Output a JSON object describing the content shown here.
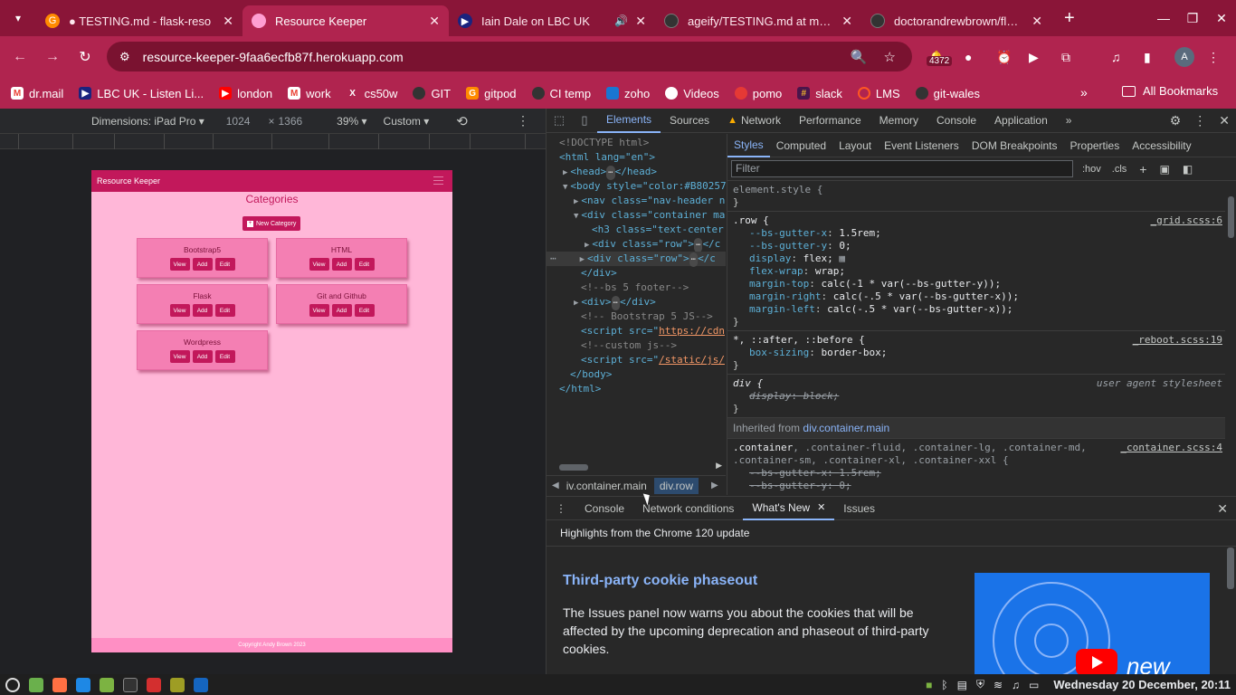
{
  "browser": {
    "tabs": [
      {
        "label": "● TESTING.md - flask-reso",
        "active": false,
        "icon": "gitpod-icon"
      },
      {
        "label": "Resource Keeper",
        "active": true,
        "icon": "pink-circle-icon"
      },
      {
        "label": "Iain Dale on LBC UK",
        "active": false,
        "icon": "lbc-icon"
      },
      {
        "label": "ageify/TESTING.md at main",
        "active": false,
        "icon": "github-icon"
      },
      {
        "label": "doctorandrewbrown/flask",
        "active": false,
        "icon": "github-icon"
      }
    ],
    "url": "resource-keeper-9faa6ecfb87f.herokuapp.com",
    "extension_badge": "4372",
    "avatar_letter": "A",
    "bookmarks": [
      {
        "label": "dr.mail",
        "icon": "gmail-icon",
        "color": "#ea4335"
      },
      {
        "label": "LBC UK - Listen Li...",
        "icon": "lbc-icon",
        "color": "#1a237e"
      },
      {
        "label": "london",
        "icon": "youtube-icon",
        "color": "#ff0000"
      },
      {
        "label": "work",
        "icon": "gmail-icon",
        "color": "#ea4335"
      },
      {
        "label": "cs50w",
        "icon": "x-icon",
        "color": "#000000"
      },
      {
        "label": "GIT",
        "icon": "github-icon",
        "color": "#333333"
      },
      {
        "label": "gitpod",
        "icon": "gitpod-icon",
        "color": "#ff8a00"
      },
      {
        "label": "CI temp",
        "icon": "github-icon",
        "color": "#333333"
      },
      {
        "label": "zoho",
        "icon": "zoho-icon",
        "color": "#1976d2"
      },
      {
        "label": "Videos",
        "icon": "globe-icon",
        "color": "#ffffff"
      },
      {
        "label": "pomo",
        "icon": "tomato-icon",
        "color": "#e53935"
      },
      {
        "label": "slack",
        "icon": "slack-icon",
        "color": "#4a154b"
      },
      {
        "label": "LMS",
        "icon": "lms-icon",
        "color": "#ff5722"
      },
      {
        "label": "git-wales",
        "icon": "github-icon",
        "color": "#333333"
      }
    ],
    "all_bookmarks": "All Bookmarks",
    "more_chevron": "»"
  },
  "device_toolbar": {
    "dimensions_label": "Dimensions: iPad Pro ▾",
    "width": "1024",
    "times": "×",
    "height": "1366",
    "zoom": "39% ▾",
    "throttle": "Custom ▾"
  },
  "site": {
    "brand": "Resource Keeper",
    "heading": "Categories",
    "new_button": "New Category",
    "categories": [
      {
        "name": "Bootstrap5"
      },
      {
        "name": "HTML"
      },
      {
        "name": "Flask"
      },
      {
        "name": "Git and Github"
      },
      {
        "name": "Wordpress"
      }
    ],
    "btn_view": "View",
    "btn_add": "Add",
    "btn_edit": "Edit",
    "footer": "Copyright Andy Brown 2023"
  },
  "devtools": {
    "tabs": [
      "Elements",
      "Sources",
      "Network",
      "Performance",
      "Memory",
      "Console",
      "Application"
    ],
    "more_tabs": "»",
    "elements_lines": [
      "<!DOCTYPE html>",
      "<html lang=\"en\">",
      "<head>",
      "</head>",
      "<body style=\"color:#B80257",
      "<nav class=\"nav-header n",
      "<div class=\"container ma",
      "<h3 class=\"text-center",
      "<div class=\"row\">",
      "</c",
      "</div>",
      "<!--bs 5 footer-->",
      "<div>",
      "</div>",
      "<!-- Bootstrap 5 JS-->",
      "<script src=\"",
      "https://cdn",
      "<!--custom js-->",
      "/static/js/",
      "</body>",
      "</html>"
    ],
    "breadcrumbs": [
      "iv.container.main",
      "div.row"
    ],
    "styles_tabs": [
      "Styles",
      "Computed",
      "Layout",
      "Event Listeners",
      "DOM Breakpoints",
      "Properties",
      "Accessibility"
    ],
    "filter_placeholder": "Filter",
    "hov": ":hov",
    "cls": ".cls",
    "rules": {
      "element_style": "element.style {",
      "close": "}",
      "row_selector": ".row {",
      "row_src": "_grid.scss:6",
      "row_props": [
        {
          "name": "--bs-gutter-x",
          "value": "1.5rem;"
        },
        {
          "name": "--bs-gutter-y",
          "value": "0;"
        },
        {
          "name": "display",
          "value": "flex;"
        },
        {
          "name": "flex-wrap",
          "value": "wrap;"
        },
        {
          "name": "margin-top",
          "value": "calc(-1 * var(--bs-gutter-y));"
        },
        {
          "name": "margin-right",
          "value": "calc(-.5 * var(--bs-gutter-x));"
        },
        {
          "name": "margin-left",
          "value": "calc(-.5 * var(--bs-gutter-x));"
        }
      ],
      "star_selector": "*, ::after, ::before {",
      "star_src": "_reboot.scss:19",
      "star_prop": {
        "name": "box-sizing",
        "value": "border-box;"
      },
      "div_selector": "div {",
      "div_src": "user agent stylesheet",
      "div_prop": {
        "name": "display",
        "value": "block;"
      },
      "inherited_label": "Inherited from",
      "inherited_from": "div.container.main",
      "container_selector": ".container",
      "container_selector_rest": ", .container-fluid, .container-lg, .container-md,",
      "container_selector_line2": ".container-sm, .container-xl, .container-xxl {",
      "container_src": "_container.scss:4",
      "container_props": [
        {
          "name": "--bs-gutter-x",
          "value": "1.5rem;"
        },
        {
          "name": "--bs-gutter-y",
          "value": "0;"
        }
      ]
    },
    "drawer": {
      "tabs": [
        "Console",
        "Network conditions",
        "What's New",
        "Issues"
      ],
      "headline": "Highlights from the Chrome 120 update",
      "feature_title": "Third-party cookie phaseout",
      "feature_text": "The Issues panel now warns you about the cookies that will be affected by the upcoming deprecation and phaseout of third-party cookies.",
      "image_word": "new"
    }
  },
  "taskbar": {
    "clock": "Wednesday 20 December, 20:11"
  }
}
